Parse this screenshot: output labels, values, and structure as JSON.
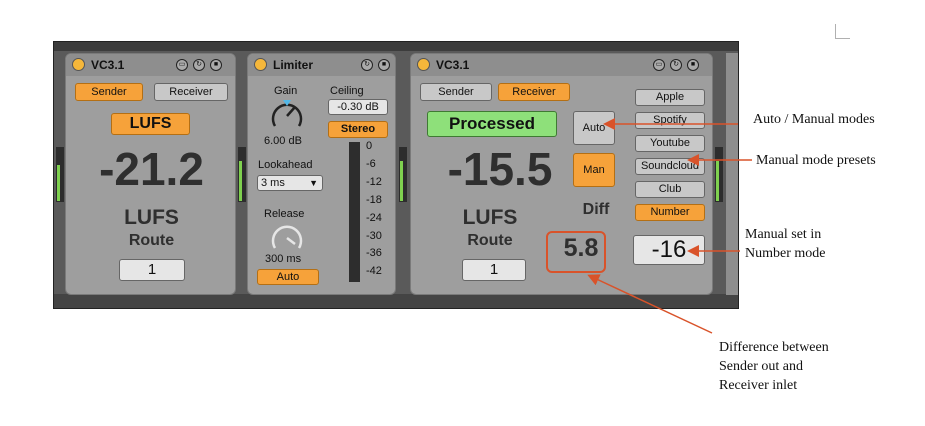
{
  "vc_sender": {
    "title": "VC3.1",
    "sender_label": "Sender",
    "receiver_label": "Receiver",
    "mode_label": "LUFS",
    "value": "-21.2",
    "unit": "LUFS",
    "route_label": "Route",
    "route_value": "1"
  },
  "limiter": {
    "title": "Limiter",
    "gain_label": "Gain",
    "gain_value": "6.00 dB",
    "ceiling_label": "Ceiling",
    "ceiling_value": "-0.30 dB",
    "stereo_label": "Stereo",
    "lookahead_label": "Lookahead",
    "lookahead_value": "3 ms",
    "release_label": "Release",
    "release_value": "300 ms",
    "auto_label": "Auto",
    "scale": [
      "0",
      "-6",
      "-12",
      "-18",
      "-24",
      "-30",
      "-36",
      "-42"
    ]
  },
  "vc_receiver": {
    "title": "VC3.1",
    "sender_label": "Sender",
    "receiver_label": "Receiver",
    "processed_label": "Processed",
    "auto_label": "Auto",
    "man_label": "Man",
    "value": "-15.5",
    "unit": "LUFS",
    "diff_label": "Diff",
    "diff_value": "5.8",
    "route_label": "Route",
    "route_value": "1",
    "presets": [
      "Apple",
      "Spotify",
      "Youtube",
      "Soundcloud",
      "Club",
      "Number"
    ],
    "number_value": "-16"
  },
  "annotations": {
    "modes": "Auto / Manual modes",
    "presets": "Manual mode presets",
    "manual_line1": "Manual set in",
    "manual_line2": "Number mode",
    "diff_line1": "Difference between",
    "diff_line2": "Sender out and",
    "diff_line3": "Receiver inlet"
  },
  "colors": {
    "accent_orange": "#f6a23a",
    "processed_green": "#8ee07a",
    "annotation_red": "#d9532a",
    "meter_green": "#7fd14f"
  }
}
